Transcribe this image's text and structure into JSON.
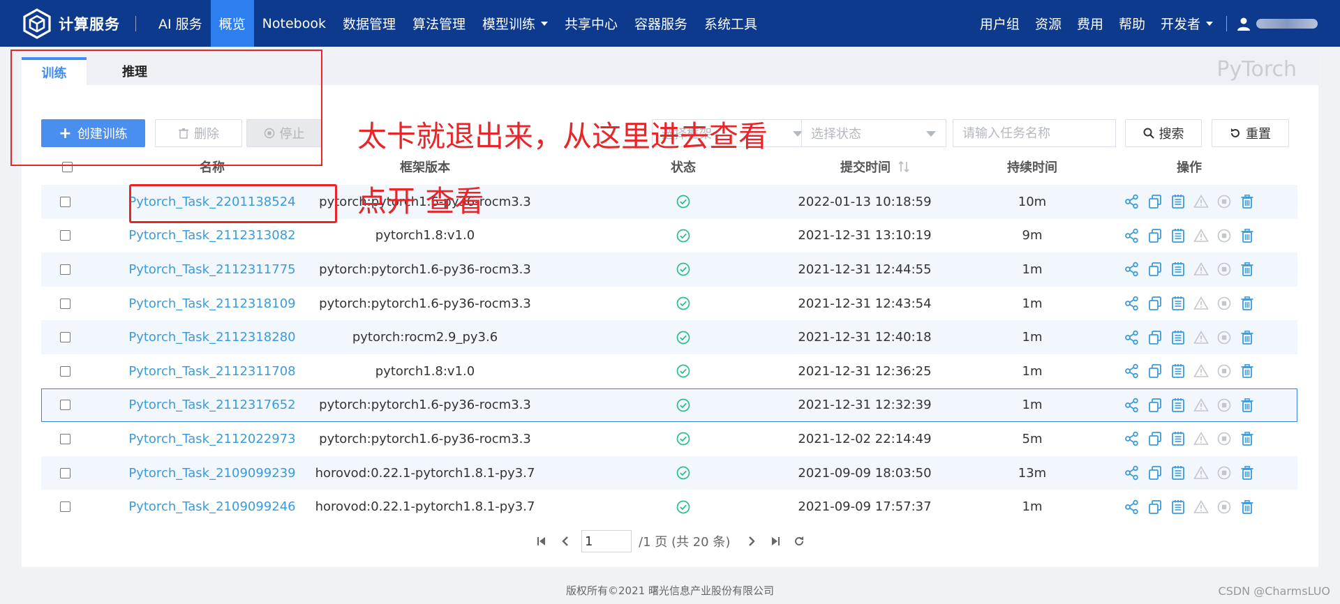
{
  "brand": {
    "name": "计算服务"
  },
  "nav": {
    "left": [
      {
        "label": "AI 服务",
        "active": false,
        "caret": false
      },
      {
        "label": "概览",
        "active": true,
        "caret": false
      },
      {
        "label": "Notebook",
        "active": false,
        "caret": false
      },
      {
        "label": "数据管理",
        "active": false,
        "caret": false
      },
      {
        "label": "算法管理",
        "active": false,
        "caret": false
      },
      {
        "label": "模型训练",
        "active": false,
        "caret": true
      },
      {
        "label": "共享中心",
        "active": false,
        "caret": false
      },
      {
        "label": "容器服务",
        "active": false,
        "caret": false
      },
      {
        "label": "系统工具",
        "active": false,
        "caret": false
      }
    ],
    "right": [
      {
        "label": "用户组",
        "caret": false
      },
      {
        "label": "资源",
        "caret": false
      },
      {
        "label": "费用",
        "caret": false
      },
      {
        "label": "帮助",
        "caret": false
      },
      {
        "label": "开发者",
        "caret": true
      }
    ]
  },
  "tabs": {
    "train": "训练",
    "infer": "推理"
  },
  "framework_title": "PyTorch",
  "toolbar": {
    "create": "创建训练",
    "delete": "删除",
    "stop": "停止",
    "framework_placeholder": "选择框架",
    "status_placeholder": "选择状态",
    "name_placeholder": "请输入任务名称",
    "search": "搜索",
    "reset": "重置"
  },
  "table": {
    "headers": {
      "name": "名称",
      "framework": "框架版本",
      "status": "状态",
      "submit_time": "提交时间",
      "duration": "持续时间",
      "actions": "操作"
    },
    "rows": [
      {
        "name": "Pytorch_Task_2201138524",
        "framework": "pytorch:pytorch1.6-py36-rocm3.3",
        "submit_time": "2022-01-13 10:18:59",
        "duration": "10m"
      },
      {
        "name": "Pytorch_Task_2112313082",
        "framework": "pytorch1.8:v1.0",
        "submit_time": "2021-12-31 13:10:19",
        "duration": "9m"
      },
      {
        "name": "Pytorch_Task_2112311775",
        "framework": "pytorch:pytorch1.6-py36-rocm3.3",
        "submit_time": "2021-12-31 12:44:55",
        "duration": "1m"
      },
      {
        "name": "Pytorch_Task_2112318109",
        "framework": "pytorch:pytorch1.6-py36-rocm3.3",
        "submit_time": "2021-12-31 12:43:54",
        "duration": "1m"
      },
      {
        "name": "Pytorch_Task_2112318280",
        "framework": "pytorch:rocm2.9_py3.6",
        "submit_time": "2021-12-31 12:40:18",
        "duration": "1m"
      },
      {
        "name": "Pytorch_Task_2112311708",
        "framework": "pytorch1.8:v1.0",
        "submit_time": "2021-12-31 12:36:25",
        "duration": "1m"
      },
      {
        "name": "Pytorch_Task_2112317652",
        "framework": "pytorch:pytorch1.6-py36-rocm3.3",
        "submit_time": "2021-12-31 12:32:39",
        "duration": "1m"
      },
      {
        "name": "Pytorch_Task_2112022973",
        "framework": "pytorch:pytorch1.6-py36-rocm3.3",
        "submit_time": "2021-12-02 22:14:49",
        "duration": "5m"
      },
      {
        "name": "Pytorch_Task_2109099239",
        "framework": "horovod:0.22.1-pytorch1.8.1-py3.7",
        "submit_time": "2021-09-09 18:03:50",
        "duration": "13m"
      },
      {
        "name": "Pytorch_Task_2109099246",
        "framework": "horovod:0.22.1-pytorch1.8.1-py3.7",
        "submit_time": "2021-09-09 17:57:37",
        "duration": "1m"
      }
    ],
    "selected_row": 6
  },
  "pager": {
    "current_page": "1",
    "summary": "/1 页 (共 20 条)"
  },
  "footer": {
    "copyright": "版权所有©2021 曙光信息产业股份有限公司"
  },
  "watermark": "CSDN @CharmsLUO",
  "annotations": {
    "note1": "太卡就退出来，从这里进去查看",
    "note2": "点开  查看"
  },
  "colors": {
    "nav_bg": "#0d3a8c",
    "nav_active": "#2d7ff0",
    "primary": "#4a8ff0",
    "link": "#3a9bdc",
    "success": "#2ebd8a",
    "annotation": "#e8262a"
  },
  "icons": {
    "row_actions": [
      "share-icon",
      "copy-icon",
      "log-icon",
      "warning-icon",
      "stop-circle-icon",
      "trash-icon"
    ]
  }
}
